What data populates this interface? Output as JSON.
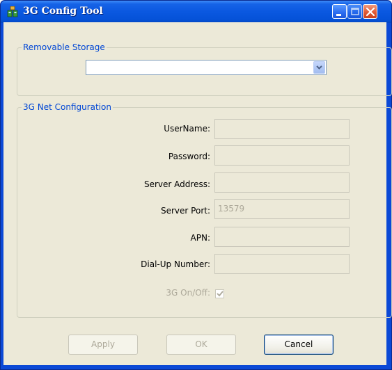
{
  "window": {
    "title": "3G Config Tool",
    "icon": "app-icon"
  },
  "storage": {
    "legend": "Removable Storage",
    "selected": ""
  },
  "net": {
    "legend": "3G Net Configuration",
    "username_label": "UserName:",
    "username_value": "",
    "password_label": "Password:",
    "password_value": "",
    "server_address_label": "Server Address:",
    "server_address_value": "",
    "server_port_label": "Server Port:",
    "server_port_value": "13579",
    "apn_label": "APN:",
    "apn_value": "",
    "dialup_label": "Dial-Up Number:",
    "dialup_value": "",
    "onoff_label": "3G On/Off:",
    "onoff_checked": true
  },
  "buttons": {
    "apply": "Apply",
    "ok": "OK",
    "cancel": "Cancel"
  },
  "colors": {
    "titlebar": "#0a58e0",
    "legend_text": "#0046d5",
    "dialog_bg": "#ece9d8",
    "disabled_text": "#aca899"
  }
}
